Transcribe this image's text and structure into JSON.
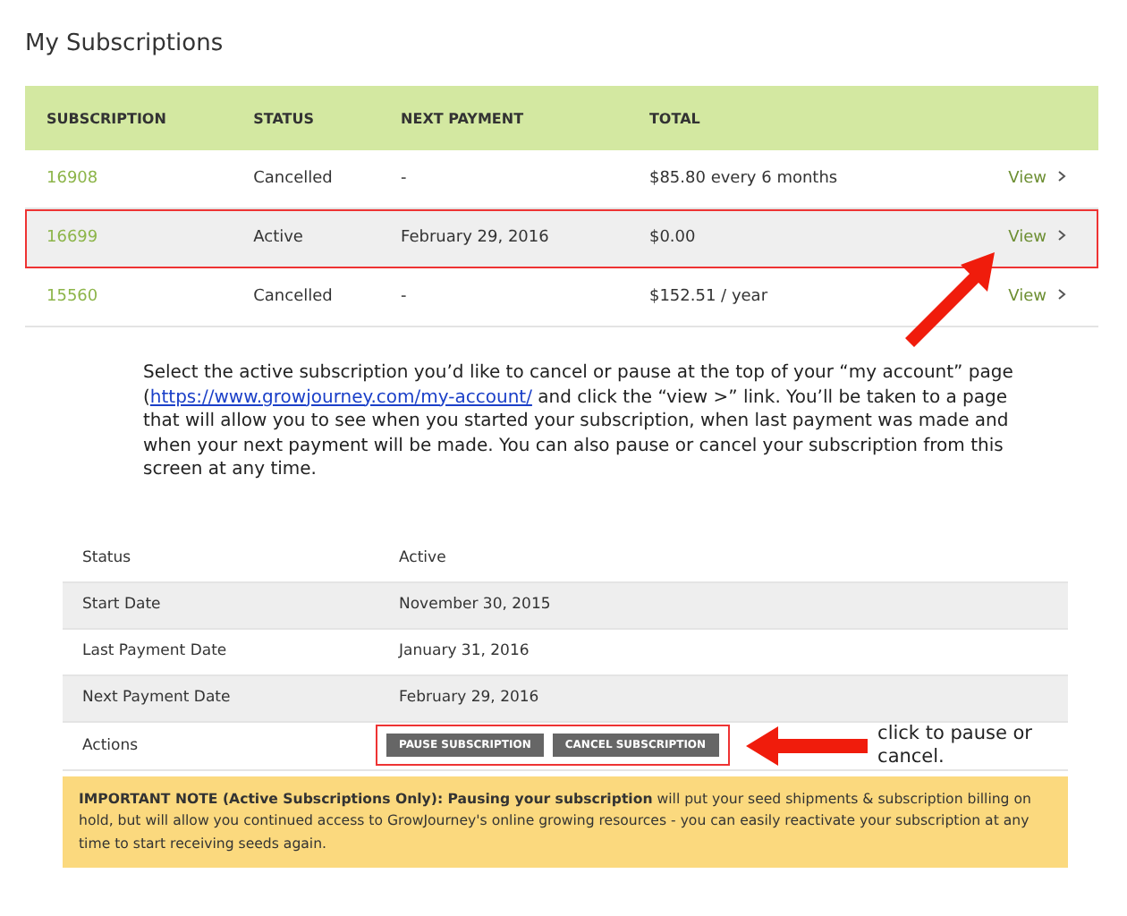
{
  "title": "My Subscriptions",
  "subscriptions": {
    "columns": [
      "SUBSCRIPTION",
      "STATUS",
      "NEXT PAYMENT",
      "TOTAL"
    ],
    "rows": [
      {
        "id": "16908",
        "status": "Cancelled",
        "next_payment": "-",
        "total": "$85.80 every 6 months",
        "action": "View",
        "selected": false
      },
      {
        "id": "16699",
        "status": "Active",
        "next_payment": "February 29, 2016",
        "total": "$0.00",
        "action": "View",
        "selected": true
      },
      {
        "id": "15560",
        "status": "Cancelled",
        "next_payment": "-",
        "total": "$152.51 / year",
        "action": "View",
        "selected": false
      }
    ]
  },
  "instructions": {
    "before": "Select the active subscription you’d like to cancel or pause at the top of your “my account” page (",
    "link": "https://www.growjourney.com/my-account/",
    "after": " and click the “view >” link. You’ll be taken to a page that will allow you to see when you started your subscription, when last payment was made and when your next payment will be made. You can also pause or cancel your subscription from this screen at any time."
  },
  "details": {
    "rows": [
      {
        "label": "Status",
        "value": "Active"
      },
      {
        "label": "Start Date",
        "value": "November 30, 2015"
      },
      {
        "label": "Last Payment Date",
        "value": "January 31, 2016"
      },
      {
        "label": "Next Payment Date",
        "value": "February 29, 2016"
      }
    ],
    "actions_label": "Actions",
    "buttons": [
      "PAUSE SUBSCRIPTION",
      "CANCEL SUBSCRIPTION"
    ]
  },
  "callout": "click to pause or cancel.",
  "note": "**IMPORTANT NOTE (Active Subscriptions Only): Pausing your subscription** will put your seed shipments & subscription billing on hold, but will allow you continued access to GrowJourney's online growing resources - you can easily reactivate your subscription at any time to start receiving seeds again."
}
